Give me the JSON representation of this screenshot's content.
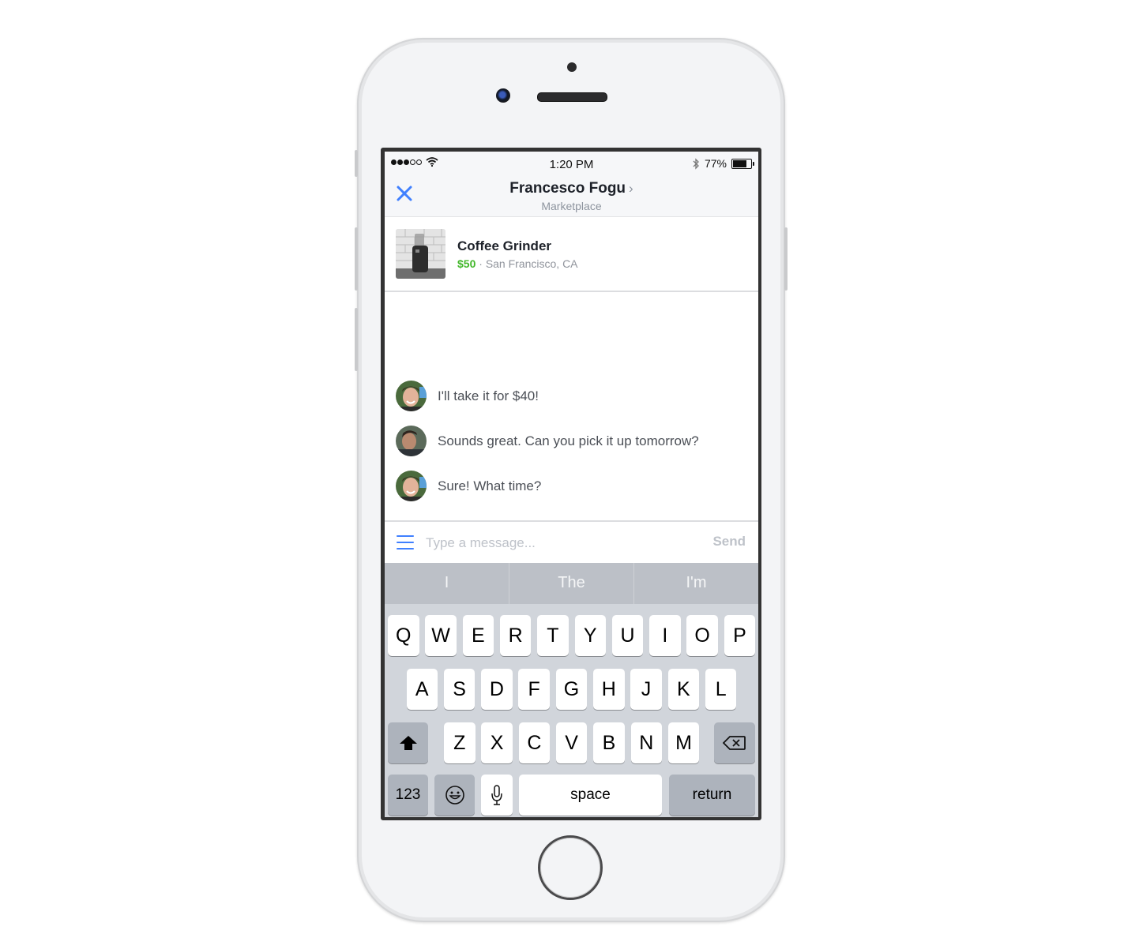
{
  "status_bar": {
    "signal_filled": 3,
    "signal_total": 5,
    "time": "1:20 PM",
    "battery_percent_label": "77%",
    "battery_level": 0.77,
    "icons": [
      "signal-icon",
      "wifi-icon",
      "bluetooth-icon",
      "battery-icon"
    ]
  },
  "nav": {
    "close_icon": "close-icon",
    "title": "Francesco Fogu",
    "title_chevron": "›",
    "subtitle": "Marketplace"
  },
  "listing": {
    "title": "Coffee Grinder",
    "price": "$50",
    "separator": " · ",
    "location": "San Francisco, CA",
    "thumbnail": "coffee-grinder-photo"
  },
  "messages": [
    {
      "sender": "buyer",
      "text": "I'll take it for $40!"
    },
    {
      "sender": "seller",
      "text": "Sounds great. Can you pick it up tomorrow?"
    },
    {
      "sender": "buyer",
      "text": "Sure! What time?"
    }
  ],
  "composer": {
    "placeholder": "Type a message...",
    "value": "",
    "send_label": "Send",
    "menu_icon": "hamburger-menu-icon"
  },
  "keyboard": {
    "suggestions": [
      "I",
      "The",
      "I'm"
    ],
    "row1": [
      "Q",
      "W",
      "E",
      "R",
      "T",
      "Y",
      "U",
      "I",
      "O",
      "P"
    ],
    "row2": [
      "A",
      "S",
      "D",
      "F",
      "G",
      "H",
      "J",
      "K",
      "L"
    ],
    "row3": [
      "Z",
      "X",
      "C",
      "V",
      "B",
      "N",
      "M"
    ],
    "numbers_label": "123",
    "space_label": "space",
    "return_label": "return"
  },
  "colors": {
    "accent": "#4080ff",
    "price_green": "#42b72a",
    "secondary_text": "#90949c"
  }
}
